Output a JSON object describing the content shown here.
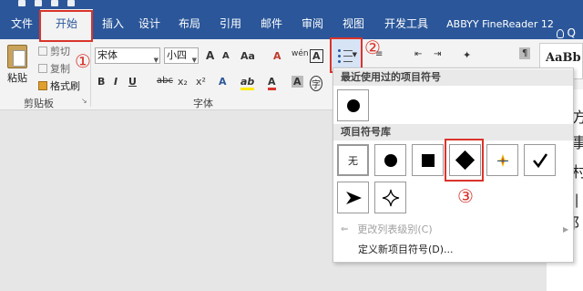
{
  "tabs": [
    "文件",
    "开始",
    "插入",
    "设计",
    "布局",
    "引用",
    "邮件",
    "审阅",
    "视图",
    "开发工具",
    "ABBYY FineReader 12"
  ],
  "tell_me": "Q",
  "clipboard": {
    "paste_label": "粘贴",
    "cut_label": "剪切",
    "copy_label": "复制",
    "format_painter_label": "格式刷",
    "group_label": "剪贴板"
  },
  "font": {
    "font_name": "宋体",
    "font_size": "小四",
    "group_label": "字体",
    "grow": "A",
    "shrink": "A",
    "aa": "Aa",
    "clear": "A",
    "pinyin": "wén",
    "char_border": "A",
    "bold": "B",
    "italic": "I",
    "underline": "U",
    "strike": "abc",
    "subscript": "x₂",
    "superscript": "x²",
    "effects": "A",
    "highlight": "ab",
    "font_color": "A",
    "shading": "A",
    "enclose": "字"
  },
  "styles_preview": "AaBb",
  "callouts": [
    "①",
    "②",
    "③"
  ],
  "dropdown": {
    "recent_header": "最近使用过的项目符号",
    "library_header": "项目符号库",
    "none_label": "无",
    "change_level": "更改列表级别(C)",
    "define_new": "定义新项目符号(D)..."
  },
  "doc_chars": [
    "方",
    "事",
    "村",
    "引邦"
  ],
  "colors": {
    "ribbon_blue": "#2b579a",
    "highlight_red": "#d9342b"
  }
}
